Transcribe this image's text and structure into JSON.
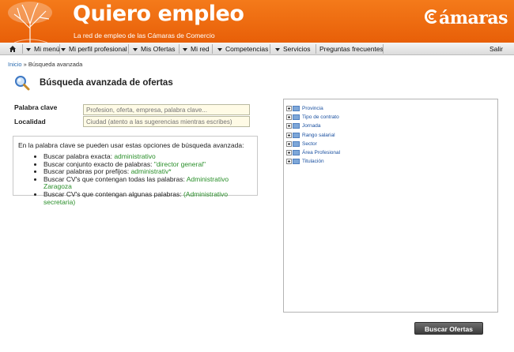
{
  "header": {
    "title": "Quiero empleo",
    "subtitle": "La red de empleo de las Cámaras de Comercio",
    "partner_logo": "ámaras",
    "colors": {
      "orange": "#e85f08",
      "accent_green": "#2a8f2a",
      "link_blue": "#1a50a0"
    }
  },
  "nav": {
    "home_icon": "home-icon",
    "items": [
      {
        "label": "Mi menú"
      },
      {
        "label": "Mi perfil profesional"
      },
      {
        "label": "Mis Ofertas"
      },
      {
        "label": "Mi red"
      },
      {
        "label": "Competencias"
      },
      {
        "label": "Servicios"
      },
      {
        "label": "Preguntas frecuentes"
      }
    ],
    "logout": "Salir"
  },
  "breadcrumb": {
    "home": "Inicio",
    "separator": "»",
    "current": "Búsqueda avanzada"
  },
  "page": {
    "title": "Búsqueda avanzada de ofertas",
    "icon": "magnifier-icon"
  },
  "form": {
    "keyword": {
      "label": "Palabra clave",
      "placeholder": "Profesion, oferta, empresa, palabra clave..."
    },
    "location": {
      "label": "Localidad",
      "placeholder": "Ciudad (atento a las sugerencias mientras escribes)"
    }
  },
  "hints": {
    "intro": "En la palabra clave se pueden usar estas opciones de búsqueda avanzada:",
    "items": [
      {
        "text": "Buscar palabra exacta: ",
        "example": "administrativo"
      },
      {
        "text": "Buscar conjunto exacto de palabras: ",
        "example": "\"director general\""
      },
      {
        "text": "Buscar palabras por prefijos: ",
        "example": "administrativ*"
      },
      {
        "text": "Buscar CV's que contengan todas las palabras: ",
        "example": "Administrativo Zaragoza"
      },
      {
        "text": "Buscar CV's que contengan algunas palabras: ",
        "example": "(Administrativo secretaria)"
      }
    ]
  },
  "filter_tree": {
    "nodes": [
      {
        "label": "Provincia"
      },
      {
        "label": "Tipo de contrato"
      },
      {
        "label": "Jornada"
      },
      {
        "label": "Rango salarial"
      },
      {
        "label": "Sector"
      },
      {
        "label": "Área Profesional"
      },
      {
        "label": "Titulación"
      }
    ]
  },
  "actions": {
    "search": "Buscar Ofertas"
  }
}
